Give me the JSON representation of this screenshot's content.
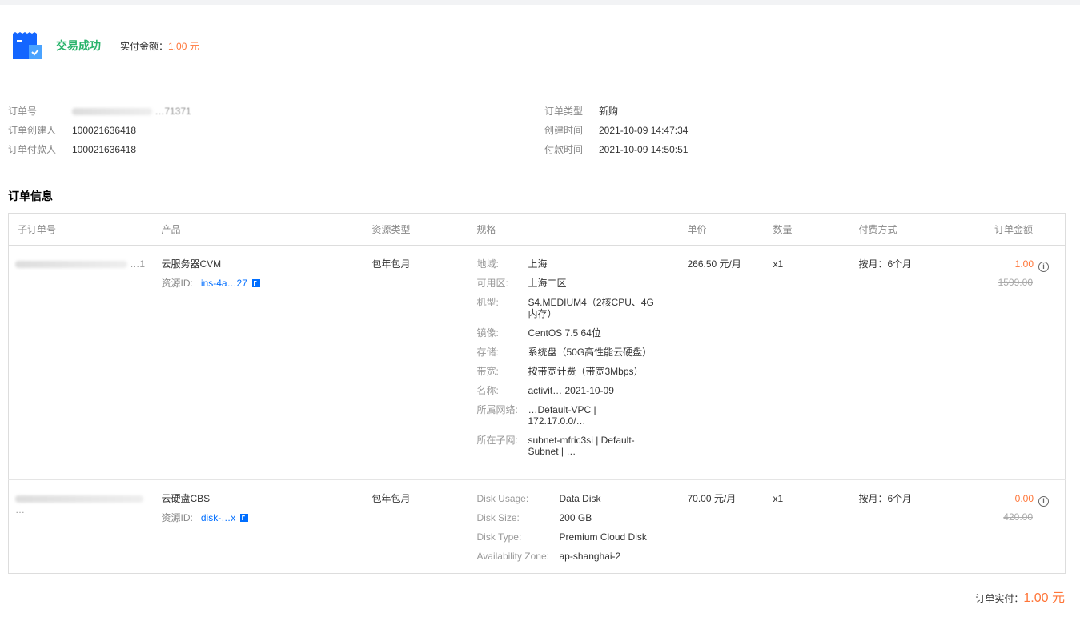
{
  "header": {
    "status": "交易成功",
    "paid_label": "实付金额：",
    "paid_value": "1.00 元",
    "icon": "receipt-check-icon"
  },
  "order_info": {
    "left": [
      {
        "label": "订单号",
        "value": "…71371",
        "masked": true
      },
      {
        "label": "订单创建人",
        "value": "100021636418"
      },
      {
        "label": "订单付款人",
        "value": "100021636418"
      }
    ],
    "right": [
      {
        "label": "订单类型",
        "value": "新购"
      },
      {
        "label": "创建时间",
        "value": "2021-10-09 14:47:34"
      },
      {
        "label": "付款时间",
        "value": "2021-10-09 14:50:51"
      }
    ]
  },
  "section_title": "订单信息",
  "table": {
    "headers": [
      "子订单号",
      "产品",
      "资源类型",
      "规格",
      "单价",
      "数量",
      "付费方式",
      "订单金额"
    ],
    "rows": [
      {
        "sub_order": "…1",
        "product": "云服务器CVM",
        "resource_label": "资源ID:",
        "resource_id": "ins-4a…27",
        "resource_type": "包年包月",
        "specs": [
          {
            "l": "地域:",
            "v": "上海"
          },
          {
            "l": "可用区:",
            "v": "上海二区"
          },
          {
            "l": "机型:",
            "v": "S4.MEDIUM4（2核CPU、4G内存）"
          },
          {
            "l": "镜像:",
            "v": "CentOS 7.5 64位"
          },
          {
            "l": "存储:",
            "v": "系统盘（50G高性能云硬盘）"
          },
          {
            "l": "带宽:",
            "v": "按带宽计费（带宽3Mbps）"
          },
          {
            "l": "名称:",
            "v": "activit… 2021-10-09"
          },
          {
            "l": "所属网络:",
            "v": "…Default-VPC | 172.17.0.0/…"
          },
          {
            "l": "所在子网:",
            "v": "subnet-mfric3si | Default-Subnet | …"
          }
        ],
        "unit_price": "266.50 元/月",
        "quantity": "x1",
        "billing": "按月：6个月",
        "amount": "1.00",
        "original": "1599.00"
      },
      {
        "sub_order": "…",
        "product": "云硬盘CBS",
        "resource_label": "资源ID:",
        "resource_id": "disk-…x",
        "resource_type": "包年包月",
        "specs": [
          {
            "l": "Disk Usage:",
            "v": "Data Disk"
          },
          {
            "l": "Disk Size:",
            "v": "200 GB"
          },
          {
            "l": "Disk Type:",
            "v": "Premium Cloud Disk"
          },
          {
            "l": "Availability Zone:",
            "v": "ap-shanghai-2"
          }
        ],
        "unit_price": "70.00 元/月",
        "quantity": "x1",
        "billing": "按月：6个月",
        "amount": "0.00",
        "original": "420.00"
      }
    ]
  },
  "footer": {
    "label": "订单实付：",
    "value": "1.00 元"
  },
  "colors": {
    "accent": "#ff7538",
    "success": "#29b36b",
    "link": "#006eff"
  }
}
